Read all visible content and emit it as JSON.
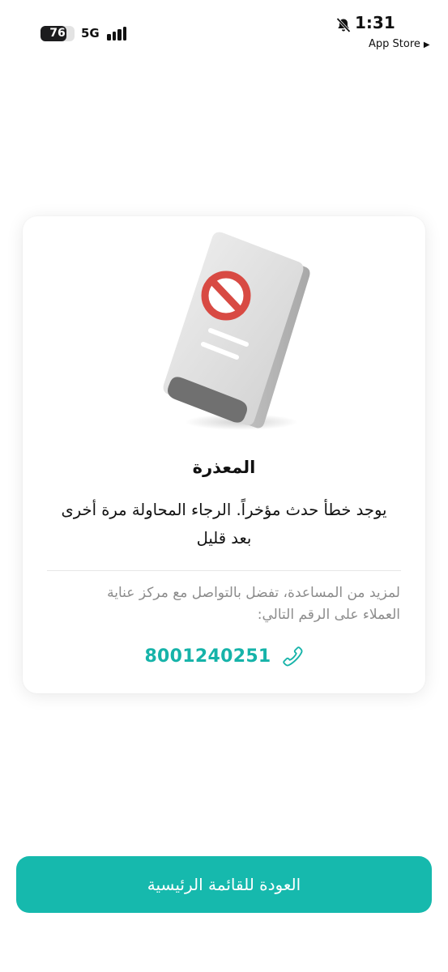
{
  "status_bar": {
    "battery": "76",
    "battery_level": 0.76,
    "network": "5G",
    "time": "1:31",
    "back_app": "App Store",
    "icons": [
      "battery-icon",
      "signal-icon",
      "bell-muted-icon"
    ]
  },
  "error_card": {
    "illustration": "blocked-phone-illustration",
    "title": "المعذرة",
    "message": "يوجد خطأ حدث مؤخراً. الرجاء المحاولة مرة أخرى بعد قليل",
    "help_text": "لمزيد من المساعدة، تفضل بالتواصل مع مركز عناية العملاء على الرقم التالي:",
    "phone_number": "8001240251",
    "phone_icon": "phone-icon"
  },
  "home_button": {
    "label": "العودة للقائمة الرئيسية"
  },
  "colors": {
    "accent": "#16b9ad",
    "phone_text": "#16b3a9",
    "help_text": "#8c8c8c",
    "background": "#ffffff"
  }
}
